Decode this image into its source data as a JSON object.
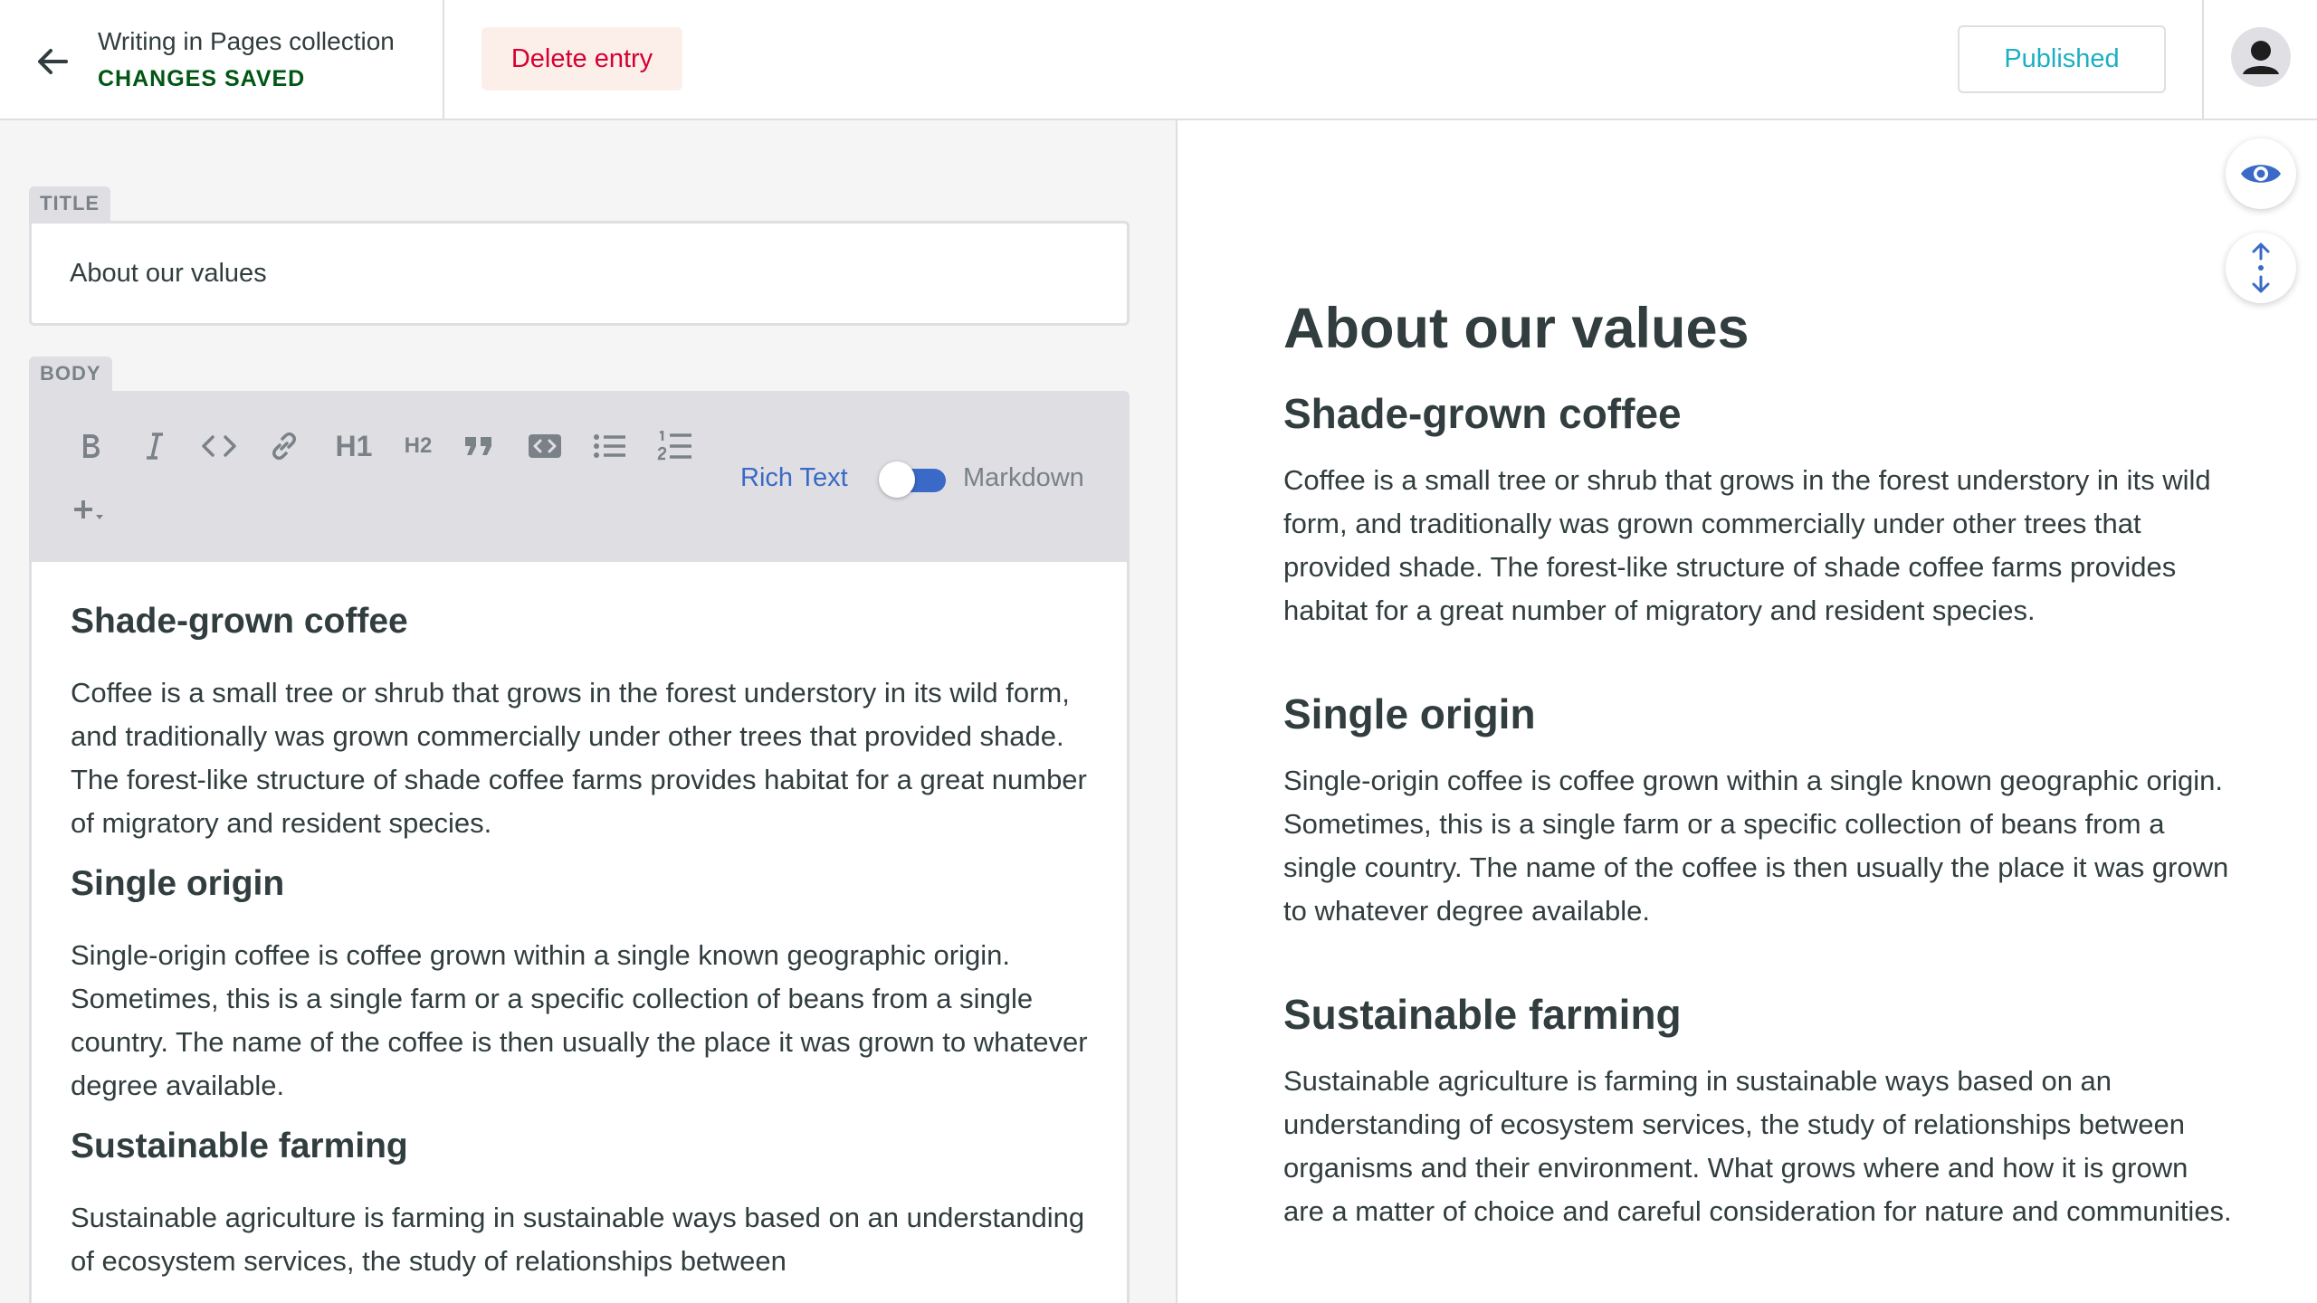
{
  "header": {
    "collection_title": "Writing in Pages collection",
    "save_status": "CHANGES SAVED",
    "delete_label": "Delete entry",
    "publish_status": "Published"
  },
  "editor": {
    "title_label": "TITLE",
    "title_value": "About our values",
    "body_label": "BODY",
    "toolbar": {
      "buttons": [
        "bold-icon",
        "italic-icon",
        "code-icon",
        "link-icon",
        "heading-one-icon",
        "heading-two-icon",
        "quote-icon",
        "code-block-icon",
        "bulleted-list-icon",
        "numbered-list-icon",
        "add-component-icon"
      ],
      "h1_glyph": "H1",
      "h2_glyph": "H2",
      "rich_text_label": "Rich Text",
      "markdown_label": "Markdown"
    },
    "content": [
      {
        "heading": "Shade-grown coffee"
      },
      {
        "paragraph": "Coffee is a small tree or shrub that grows in the forest understory in its wild form, and traditionally was grown commercially under other trees that provided shade. The forest-like structure of shade coffee farms provides habitat for a great number of migratory and resident species."
      },
      {
        "heading": "Single origin"
      },
      {
        "paragraph": "Single-origin coffee is coffee grown within a single known geographic origin. Sometimes, this is a single farm or a specific collection of beans from a single country. The name of the coffee is then usually the place it was grown to whatever degree available."
      },
      {
        "heading": "Sustainable farming"
      },
      {
        "paragraph": "Sustainable agriculture is farming in sustainable ways based on an understanding of ecosystem services, the study of relationships between"
      }
    ]
  },
  "preview": {
    "title": "About our values",
    "sections": [
      {
        "heading": "Shade-grown coffee",
        "text": "Coffee is a small tree or shrub that grows in the forest understory in its wild form, and traditionally was grown commercially under other trees that provided shade. The forest-like structure of shade coffee farms provides habitat for a great number of migratory and resident species."
      },
      {
        "heading": "Single origin",
        "text": "Single-origin coffee is coffee grown within a single known geographic origin. Sometimes, this is a single farm or a specific collection of beans from a single country. The name of the coffee is then usually the place it was grown to whatever degree available."
      },
      {
        "heading": "Sustainable farming",
        "text": "Sustainable agriculture is farming in sustainable ways based on an understanding of ecosystem services, the study of relationships between organisms and their environment. What grows where and how it is grown are a matter of choice and careful consideration for nature and communities."
      }
    ]
  },
  "colors": {
    "status_green": "#005614",
    "delete_red": "#d60032",
    "delete_bg": "#fcefea",
    "publish_teal": "#1dafc2",
    "accent_blue": "#3a69c7"
  }
}
